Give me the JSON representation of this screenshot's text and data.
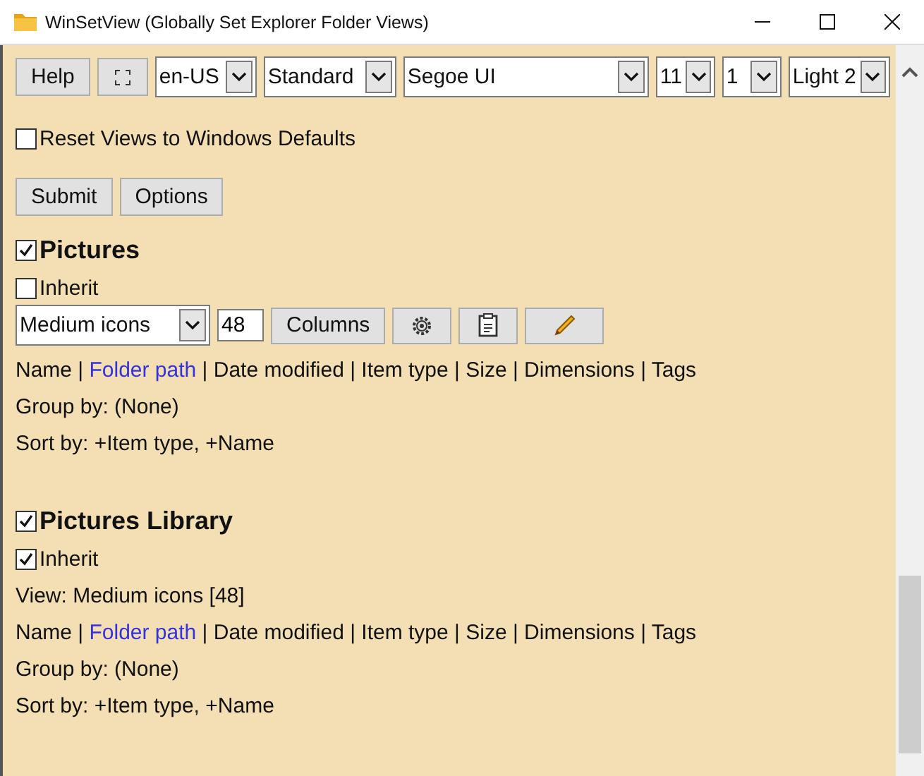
{
  "window": {
    "title": "WinSetView (Globally Set Explorer Folder Views)"
  },
  "toolbar": {
    "help_button": "Help",
    "selects": [
      "en-US",
      "Standard",
      "Segoe UI",
      "11",
      "1",
      "Light 2"
    ]
  },
  "reset": {
    "label": "Reset Views to Windows Defaults",
    "checked": false
  },
  "actions": [
    "Submit",
    "Options"
  ],
  "separator": " | ",
  "sections": [
    {
      "title": "Pictures",
      "checked": true,
      "inherit": {
        "label": "Inherit",
        "checked": false
      },
      "view_select": "Medium icons",
      "icon_size": "48",
      "columns_button": "Columns",
      "columns": [
        {
          "label": "Name",
          "highlighted": false
        },
        {
          "label": "Folder path",
          "highlighted": true
        },
        {
          "label": "Date modified",
          "highlighted": false
        },
        {
          "label": "Item type",
          "highlighted": false
        },
        {
          "label": "Size",
          "highlighted": false
        },
        {
          "label": "Dimensions",
          "highlighted": false
        },
        {
          "label": "Tags",
          "highlighted": false
        }
      ],
      "group_by": "Group by: (None)",
      "sort_by": "Sort by: +Item type, +Name"
    },
    {
      "title": "Pictures Library",
      "checked": true,
      "inherit": {
        "label": "Inherit",
        "checked": true
      },
      "view_text": "View: Medium icons [48]",
      "columns": [
        {
          "label": "Name",
          "highlighted": false
        },
        {
          "label": "Folder path",
          "highlighted": true
        },
        {
          "label": "Date modified",
          "highlighted": false
        },
        {
          "label": "Item type",
          "highlighted": false
        },
        {
          "label": "Size",
          "highlighted": false
        },
        {
          "label": "Dimensions",
          "highlighted": false
        },
        {
          "label": "Tags",
          "highlighted": false
        }
      ],
      "group_by": "Group by: (None)",
      "sort_by": "Sort by: +Item type, +Name"
    }
  ]
}
